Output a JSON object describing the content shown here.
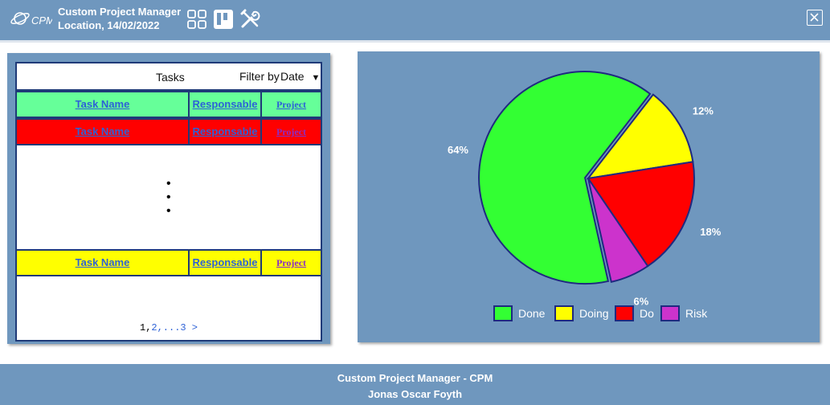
{
  "header": {
    "logo_text": "CPM",
    "app_name": "Custom Project Manager",
    "location_date": "Location, 14/02/2022",
    "icons": [
      "dashboard-grid-icon",
      "kanban-board-icon",
      "tools-icon"
    ],
    "close_icon": "close-icon"
  },
  "tasks": {
    "title": "Tasks",
    "filter_label": "Filter by",
    "filter_value": "Date",
    "filter_arrow": "▼",
    "rows": [
      {
        "name": "Task Name",
        "responsable": "Responsable",
        "project": "Project",
        "color": "#66ff99",
        "project_color": "#2d61d6"
      },
      {
        "name": "Task Name",
        "responsable": "Responsable",
        "project": "Project",
        "color": "#ff0000",
        "project_color": "#8b2cc4"
      },
      {
        "name": "Task Name",
        "responsable": "Responsable",
        "project": "Project",
        "color": "#ffff00",
        "project_color": "#8b2cc4"
      }
    ],
    "ellipsis": "•",
    "pagination": {
      "first": "1",
      "sep": ",",
      "second": "2",
      "dots": ",...",
      "last": "3",
      "next": " >"
    }
  },
  "chart_data": {
    "type": "pie",
    "categories": [
      "Done",
      "Doing",
      "Do",
      "Risk"
    ],
    "values": [
      64,
      12,
      18,
      6
    ],
    "labels": [
      "64%",
      "12%",
      "18%",
      "6%"
    ],
    "colors": [
      "#33ff33",
      "#ffff00",
      "#ff0000",
      "#cc33cc"
    ],
    "exploded": "Done",
    "legend_position": "bottom"
  },
  "footer": {
    "line1": "Custom Project Manager - CPM",
    "line2": "Jonas Oscar Foyth"
  }
}
